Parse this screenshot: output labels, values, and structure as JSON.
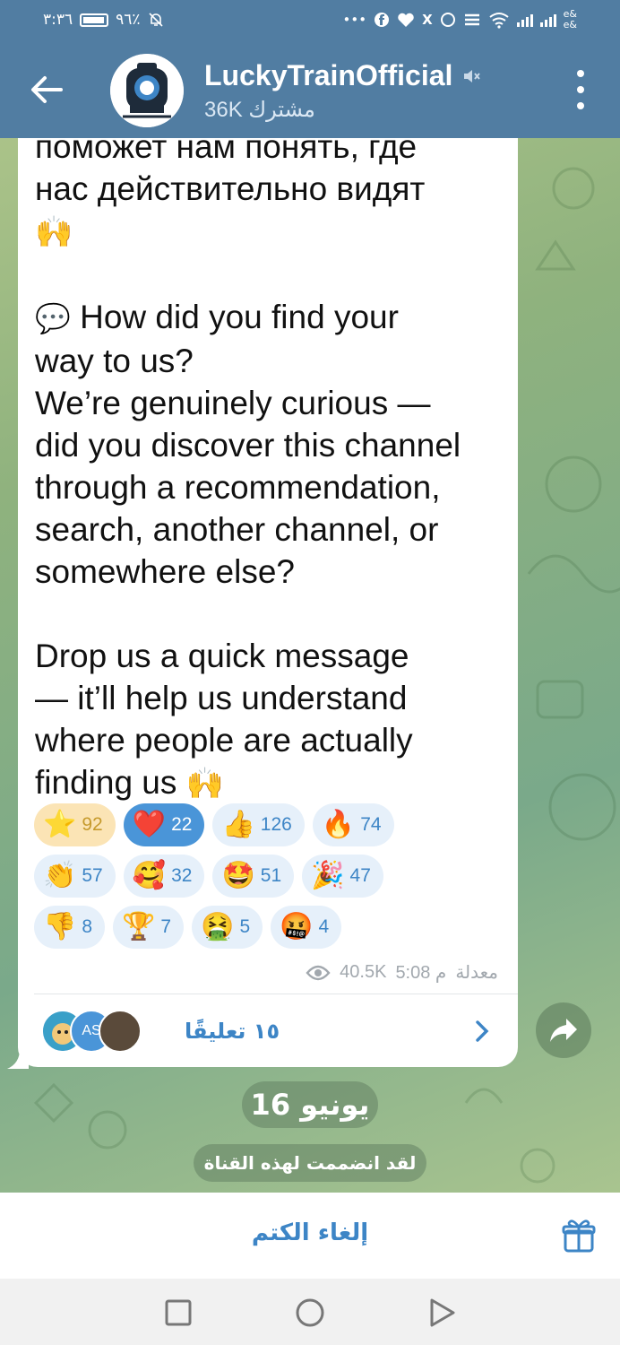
{
  "status_bar": {
    "time": "٣:٣٦",
    "battery": "٩٦٪",
    "carrier_line1": "e&",
    "carrier_line2": "e&",
    "icons": [
      "battery-icon",
      "mute-bell-icon",
      "more-icon",
      "facebook-icon",
      "heart-icon",
      "x-icon",
      "whatsapp-icon",
      "app-icon",
      "wifi-icon",
      "signal-icon"
    ]
  },
  "header": {
    "title": "LuckyTrainOfficial",
    "subscribers": "36K مشترك",
    "muted": true
  },
  "message": {
    "text_top": "поможет нам понять, где\nнас действительно видят\n",
    "text_question": "How did you find your\nway to us?\nWe’re genuinely curious —\ndid you discover this channel\nthrough a recommendation,\nsearch, another channel, or\nsomewhere else?\n\nDrop us a quick message\n— it’ll help us understand\nwhere people are actually\nfinding us ",
    "emoji_hands": "🙌",
    "emoji_speech": "💬",
    "reactions": [
      [
        {
          "emoji": "⭐",
          "count": "92",
          "style": "star"
        },
        {
          "emoji": "❤️",
          "count": "22",
          "style": "selected"
        },
        {
          "emoji": "👍",
          "count": "126",
          "style": "normal"
        },
        {
          "emoji": "🔥",
          "count": "74",
          "style": "normal"
        }
      ],
      [
        {
          "emoji": "👏",
          "count": "57",
          "style": "normal"
        },
        {
          "emoji": "🥰",
          "count": "32",
          "style": "normal"
        },
        {
          "emoji": "🤩",
          "count": "51",
          "style": "normal"
        },
        {
          "emoji": "🎉",
          "count": "47",
          "style": "normal"
        }
      ],
      [
        {
          "emoji": "👎",
          "count": "8",
          "style": "normal"
        },
        {
          "emoji": "🏆",
          "count": "7",
          "style": "normal"
        },
        {
          "emoji": "🤮",
          "count": "5",
          "style": "normal"
        },
        {
          "emoji": "🤬",
          "count": "4",
          "style": "normal"
        }
      ]
    ],
    "edited_label": "معدلة",
    "time": "5:08 م",
    "views": "40.5K",
    "comments_label": "١٥ تعليقًا",
    "commenter_initials": "AS"
  },
  "date_separator": "16 يونيو",
  "joined_notice": "لقد انضممت لهذه القناة",
  "bottom": {
    "unmute_label": "إلغاء الكتم"
  },
  "colors": {
    "header": "#517da2",
    "accent": "#3d85c6",
    "bubble": "#ffffff"
  }
}
